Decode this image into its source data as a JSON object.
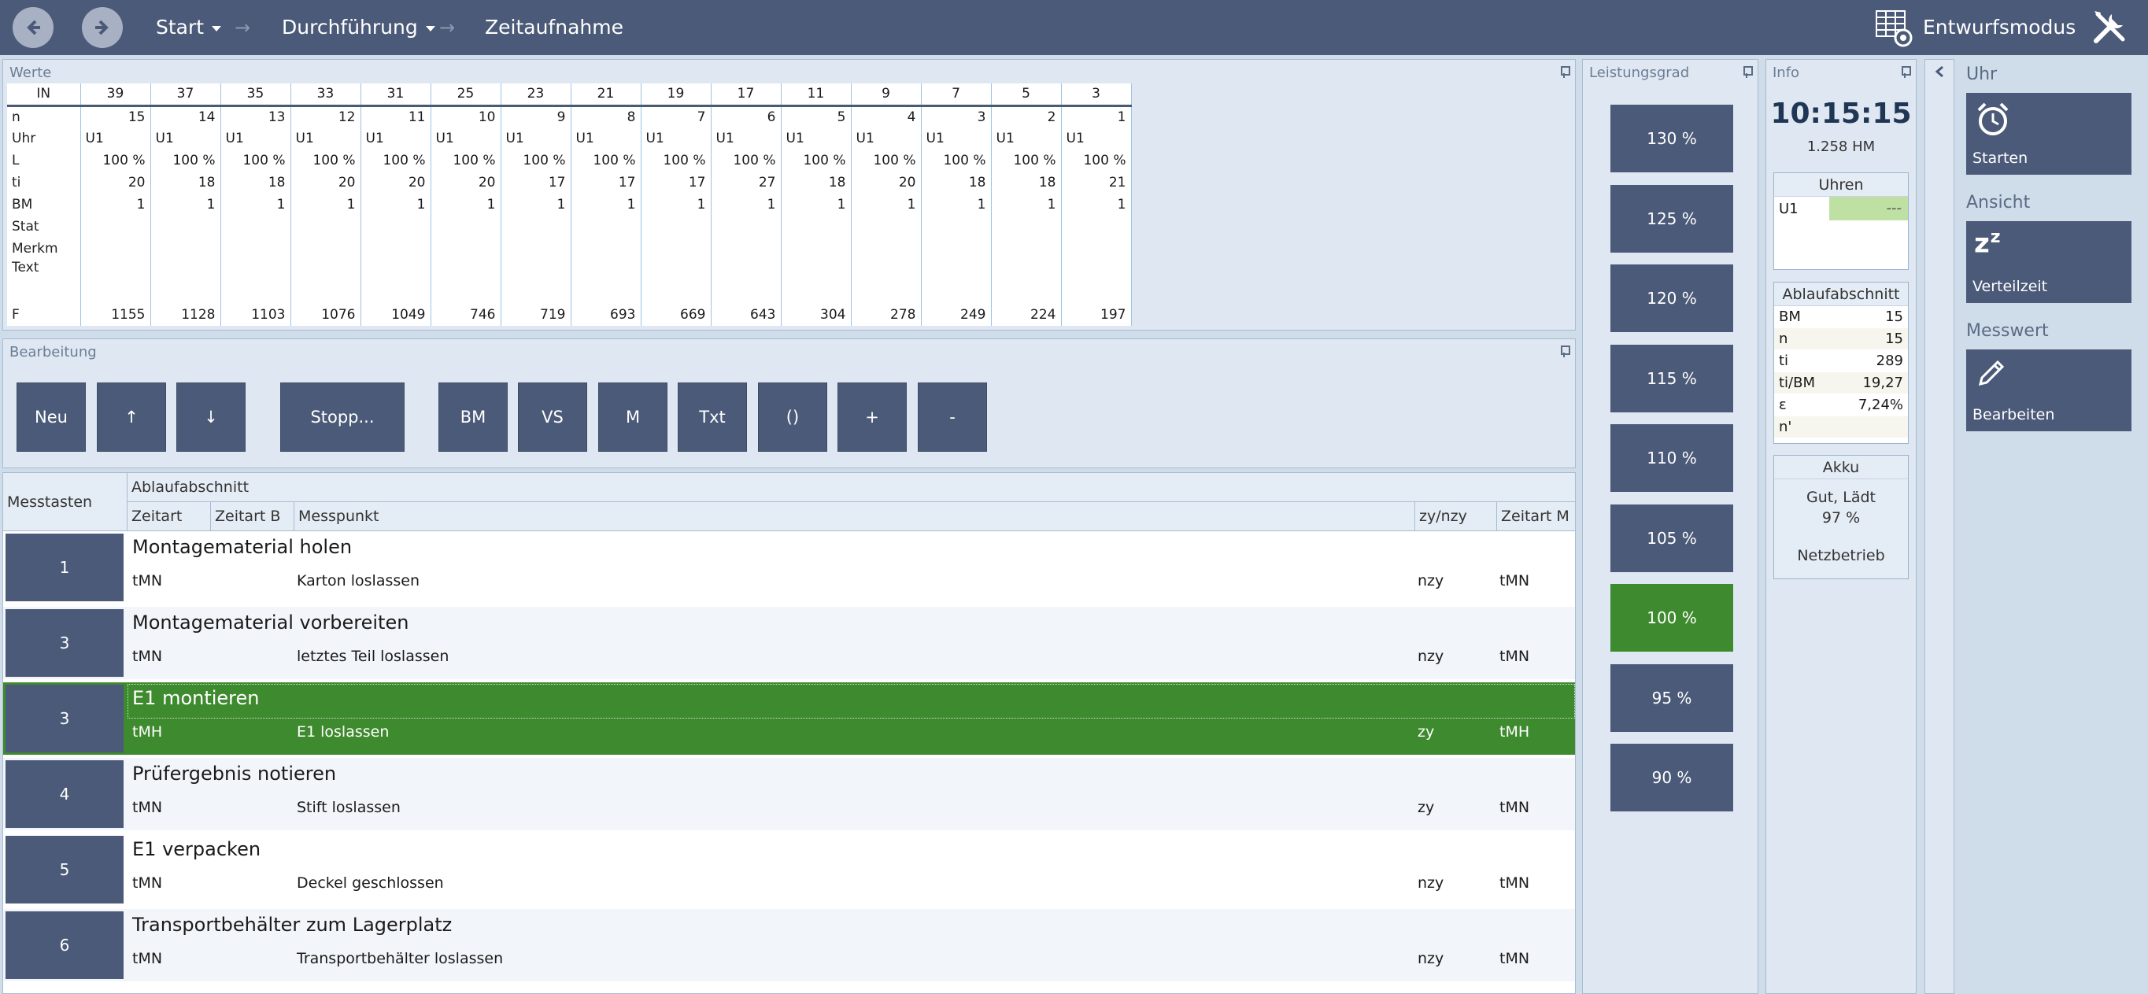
{
  "topbar": {
    "crumbs": [
      "Start",
      "Durchführung",
      "Zeitaufnahme"
    ],
    "entwurfsmodus": "Entwurfsmodus"
  },
  "werte": {
    "title": "Werte",
    "rows": [
      {
        "label": "IN",
        "values": [
          "39",
          "37",
          "35",
          "33",
          "31",
          "25",
          "23",
          "21",
          "19",
          "17",
          "11",
          "9",
          "7",
          "5",
          "3"
        ]
      },
      {
        "label": "n",
        "values": [
          "15",
          "14",
          "13",
          "12",
          "11",
          "10",
          "9",
          "8",
          "7",
          "6",
          "5",
          "4",
          "3",
          "2",
          "1"
        ]
      },
      {
        "label": "Uhr",
        "values": [
          "U1",
          "U1",
          "U1",
          "U1",
          "U1",
          "U1",
          "U1",
          "U1",
          "U1",
          "U1",
          "U1",
          "U1",
          "U1",
          "U1",
          "U1"
        ]
      },
      {
        "label": "L",
        "values": [
          "100 %",
          "100 %",
          "100 %",
          "100 %",
          "100 %",
          "100 %",
          "100 %",
          "100 %",
          "100 %",
          "100 %",
          "100 %",
          "100 %",
          "100 %",
          "100 %",
          "100 %"
        ]
      },
      {
        "label": "ti",
        "values": [
          "20",
          "18",
          "18",
          "20",
          "20",
          "20",
          "17",
          "17",
          "17",
          "27",
          "18",
          "20",
          "18",
          "18",
          "21"
        ]
      },
      {
        "label": "BM",
        "values": [
          "1",
          "1",
          "1",
          "1",
          "1",
          "1",
          "1",
          "1",
          "1",
          "1",
          "1",
          "1",
          "1",
          "1",
          "1"
        ]
      },
      {
        "label": "Stat",
        "values": [
          "",
          "",
          "",
          "",
          "",
          "",
          "",
          "",
          "",
          "",
          "",
          "",
          "",
          "",
          ""
        ]
      },
      {
        "label": "Merkm",
        "values": [
          "",
          "",
          "",
          "",
          "",
          "",
          "",
          "",
          "",
          "",
          "",
          "",
          "",
          "",
          ""
        ]
      },
      {
        "label": "Text",
        "values": [
          "",
          "",
          "",
          "",
          "",
          "",
          "",
          "",
          "",
          "",
          "",
          "",
          "",
          "",
          ""
        ]
      },
      {
        "label": "F",
        "values": [
          "1155",
          "1128",
          "1103",
          "1076",
          "1049",
          "746",
          "719",
          "693",
          "669",
          "643",
          "304",
          "278",
          "249",
          "224",
          "197"
        ]
      }
    ]
  },
  "bearbeitung": {
    "title": "Bearbeitung",
    "buttons": [
      "Neu",
      "↑",
      "↓",
      "Stopp...",
      "BM",
      "VS",
      "M",
      "Txt",
      "()",
      "+",
      "-"
    ]
  },
  "grid": {
    "header": {
      "messtasten": "Messtasten",
      "ablauf": "Ablaufabschnitt",
      "zeitart": "Zeitart",
      "zeitartb": "Zeitart B",
      "messpunkt": "Messpunkt",
      "zy": "zy/nzy",
      "zeitartm": "Zeitart M"
    },
    "rows": [
      {
        "key": "1",
        "title": "Montagematerial holen",
        "zeitart": "tMN",
        "messpunkt": "Karton loslassen",
        "zy": "nzy",
        "zeitartm": "tMN"
      },
      {
        "key": "3",
        "title": "Montagematerial vorbereiten",
        "zeitart": "tMN",
        "messpunkt": "letztes Teil loslassen",
        "zy": "nzy",
        "zeitartm": "tMN"
      },
      {
        "key": "3",
        "title": "E1 montieren",
        "zeitart": "tMH",
        "messpunkt": "E1 loslassen",
        "zy": "zy",
        "zeitartm": "tMH"
      },
      {
        "key": "4",
        "title": "Prüfergebnis notieren",
        "zeitart": "tMN",
        "messpunkt": "Stift loslassen",
        "zy": "zy",
        "zeitartm": "tMN"
      },
      {
        "key": "5",
        "title": "E1 verpacken",
        "zeitart": "tMN",
        "messpunkt": "Deckel geschlossen",
        "zy": "nzy",
        "zeitartm": "tMN"
      },
      {
        "key": "6",
        "title": "Transportbehälter zum Lagerplatz",
        "zeitart": "tMN",
        "messpunkt": "Transportbehälter loslassen",
        "zy": "nzy",
        "zeitartm": "tMN"
      }
    ],
    "selected_index": 2
  },
  "leistungsgrad": {
    "title": "Leistungsgrad",
    "options": [
      "130 %",
      "125 %",
      "120 %",
      "115 %",
      "110 %",
      "105 %",
      "100 %",
      "95 %",
      "90 %"
    ],
    "active": "100 %"
  },
  "info": {
    "title": "Info",
    "time": "10:15:15",
    "hm": "1.258 HM",
    "uhren": {
      "title": "Uhren",
      "label": "U1",
      "value": "---"
    },
    "ablauf": {
      "title": "Ablaufabschnitt",
      "items": [
        {
          "k": "BM",
          "v": "15"
        },
        {
          "k": "n",
          "v": "15"
        },
        {
          "k": "ti",
          "v": "289"
        },
        {
          "k": "ti/BM",
          "v": "19,27"
        },
        {
          "k": "ε",
          "v": "7,24%"
        },
        {
          "k": "n'",
          "v": ""
        }
      ]
    },
    "akku": {
      "title": "Akku",
      "status": "Gut, Lädt",
      "percent": "97 %",
      "source": "Netzbetrieb"
    }
  },
  "ribbon": {
    "uhr": {
      "section": "Uhr",
      "button": "Starten"
    },
    "ansicht": {
      "section": "Ansicht",
      "button": "Verteilzeit"
    },
    "messwert": {
      "section": "Messwert",
      "button": "Bearbeiten"
    }
  },
  "colors": {
    "accent": "#4b5a78",
    "active": "#3e8a2e",
    "background": "#cfdcea"
  }
}
